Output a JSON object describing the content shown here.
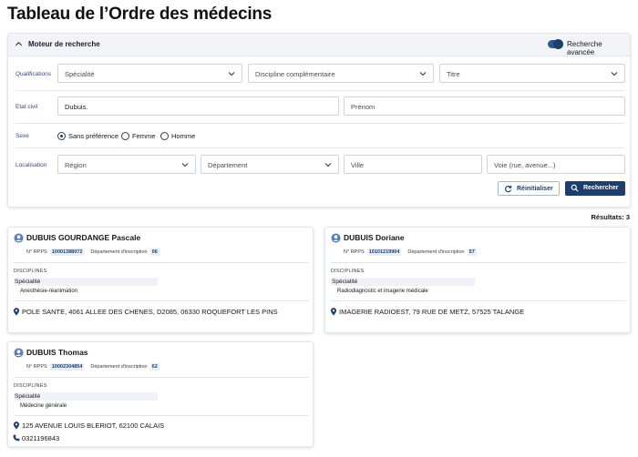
{
  "page": {
    "title": "Tableau de l’Ordre des médecins"
  },
  "search": {
    "panel_title": "Moteur de recherche",
    "advanced_label": "Recherche avancée",
    "rows": {
      "qualifications_label": "Qualifications",
      "etat_civil_label": "Etat civil",
      "sexe_label": "Sexe",
      "localisation_label": "Localisation"
    },
    "fields": {
      "specialite": "Spécialité",
      "discipline": "Discipline complémentaire",
      "titre": "Titre",
      "nom_value": "Dubuis.",
      "prenom": "Prénom",
      "region": "Région",
      "departement": "Département",
      "ville": "Ville",
      "voie": "Voie (rue, avenue...)"
    },
    "sexe_options": [
      "Sans préférence",
      "Femme",
      "Homme"
    ],
    "sexe_selected": "Sans préférence",
    "reset_label": "Réinitialiser",
    "search_label": "Rechercher"
  },
  "results_label": "Résultats: 3",
  "labels": {
    "rpps": "N° RPPS",
    "dept": "Département d'inscription",
    "disciplines": "DISCIPLINES",
    "specialite": "Spécialité"
  },
  "results": [
    {
      "name": "DUBUIS GOURDANGE Pascale",
      "rpps": "10001388072",
      "dept": "06",
      "specialty": "Anesthésie-réanimation",
      "address": "POLE SANTE, 4061 ALLEE DES CHENES, D2085, 06330 ROQUEFORT LES PINS",
      "phone": ""
    },
    {
      "name": "DUBUIS Doriane",
      "rpps": "10101219904",
      "dept": "57",
      "specialty": "Radiodiagnostic et imagerie médicale",
      "address": "IMAGERIE RADIOEST, 79 RUE DE METZ, 57525 TALANGE",
      "phone": ""
    },
    {
      "name": "DUBUIS Thomas",
      "rpps": "10002304854",
      "dept": "62",
      "specialty": "Médecine générale",
      "address": "125 AVENUE LOUIS BLERIOT, 62100 CALAIS",
      "phone": "0321196843"
    }
  ],
  "colors": {
    "primary": "#1e3f6b",
    "header_bg": "#f3f4f8",
    "tag_bg": "#e8edf6"
  }
}
